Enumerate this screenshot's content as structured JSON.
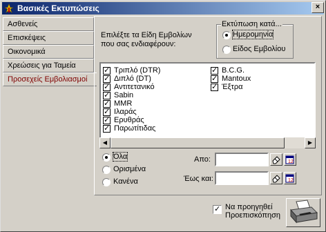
{
  "window": {
    "title": "Βασικές Εκτυπώσεις",
    "close": "×"
  },
  "tabs": [
    {
      "label": "Ασθενείς"
    },
    {
      "label": "Επισκέψεις"
    },
    {
      "label": "Οικονομικά"
    },
    {
      "label": "Χρεώσεις για Ταμεία"
    },
    {
      "label": "Προσεχείς Εμβολιασμοί"
    }
  ],
  "active_tab": "Προσεχείς Εμβολιασμοί",
  "instruction": {
    "line1": "Επιλέξτε τα Είδη Εμβολίων",
    "line2": "που σας ενδιαφέρουν:"
  },
  "print_by": {
    "title": "Εκτύπωση κατά...",
    "options": [
      {
        "label": "Ημερομηνία",
        "selected": true
      },
      {
        "label": "Είδος Εμβολίου",
        "selected": false
      }
    ]
  },
  "vaccines": {
    "col1": [
      {
        "label": "Τριπλό (DTR)",
        "checked": true
      },
      {
        "label": "Διπλό (DT)",
        "checked": true
      },
      {
        "label": "Αντιτετανικό",
        "checked": true
      },
      {
        "label": "Sabin",
        "checked": true
      },
      {
        "label": "MMR",
        "checked": true
      },
      {
        "label": "Ιλαράς",
        "checked": true
      },
      {
        "label": "Ερυθράς",
        "checked": true
      },
      {
        "label": "Παρωτίτιδας",
        "checked": true
      }
    ],
    "col2": [
      {
        "label": "B.C.G.",
        "checked": true
      },
      {
        "label": "Mantoux",
        "checked": true
      },
      {
        "label": "Έξτρα",
        "checked": true
      }
    ]
  },
  "scope": {
    "options": [
      {
        "label": "Όλα",
        "selected": true
      },
      {
        "label": "Ορισμένα",
        "selected": false
      },
      {
        "label": "Κανένα",
        "selected": false
      }
    ]
  },
  "date_from": {
    "label": "Απο:",
    "value": ""
  },
  "date_to": {
    "label": "Έως και:",
    "value": ""
  },
  "preview": {
    "label_line1": "Να προηγηθεί",
    "label_line2": "Προεπισκόπηση",
    "checked": true
  },
  "colors": {
    "title_start": "#0a246a",
    "title_end": "#a6caf0",
    "active_tab_text": "#800000"
  }
}
